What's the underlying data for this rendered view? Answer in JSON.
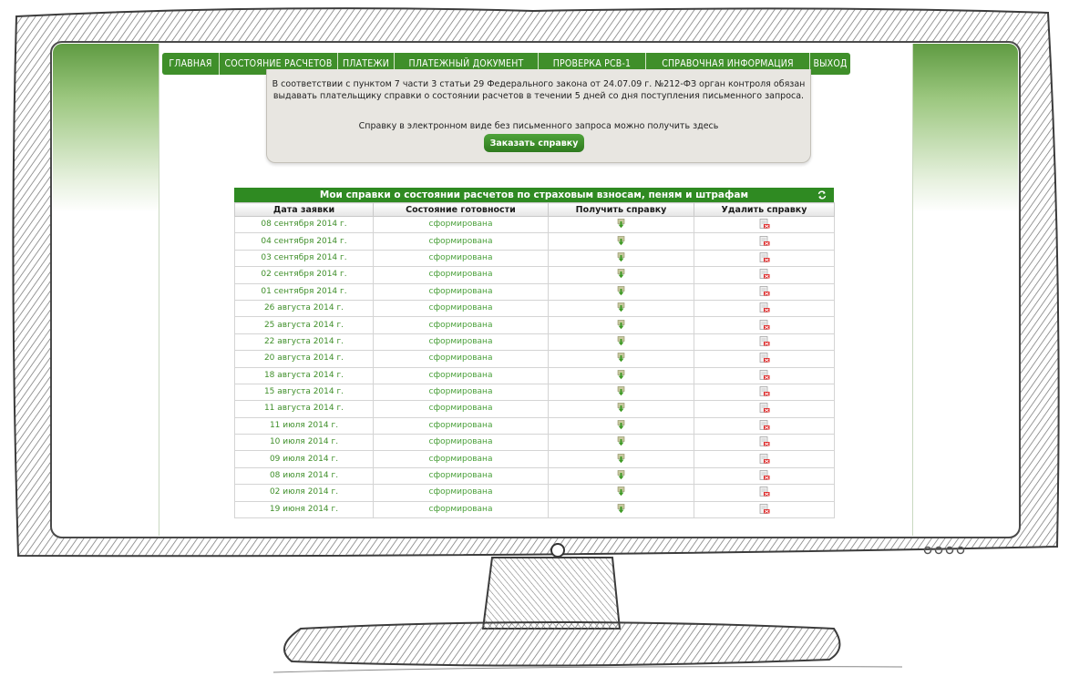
{
  "nav": {
    "items": [
      "ГЛАВНАЯ",
      "СОСТОЯНИЕ РАСЧЕТОВ",
      "ПЛАТЕЖИ",
      "ПЛАТЕЖНЫЙ ДОКУМЕНТ",
      "ПРОВЕРКА РСВ-1",
      "СПРАВОЧНАЯ ИНФОРМАЦИЯ",
      "ВЫХОД"
    ]
  },
  "notice": {
    "line1": "В соответствии с пунктом 7 части 3 статьи 29 Федерального закона от 24.07.09 г. №212-ФЗ орган контроля обязан",
    "line2": "выдавать плательщику справки о состоянии расчетов в течении 5 дней со дня поступления письменного запроса.",
    "line3": "Справку в электронном виде без письменного запроса можно получить здесь",
    "button_label": "Заказать справку"
  },
  "table": {
    "title": "Мои справки о состоянии расчетов по страховым взносам, пеням и штрафам",
    "headers": [
      "Дата заявки",
      "Состояние готовности",
      "Получить справку",
      "Удалить справку"
    ],
    "rows": [
      {
        "date": "08 сентября 2014 г.",
        "status": "сформирована"
      },
      {
        "date": "04 сентября 2014 г.",
        "status": "сформирована"
      },
      {
        "date": "03 сентября 2014 г.",
        "status": "сформирована"
      },
      {
        "date": "02 сентября 2014 г.",
        "status": "сформирована"
      },
      {
        "date": "01 сентября 2014 г.",
        "status": "сформирована"
      },
      {
        "date": "26 августа 2014 г.",
        "status": "сформирована"
      },
      {
        "date": "25 августа 2014 г.",
        "status": "сформирована"
      },
      {
        "date": "22 августа 2014 г.",
        "status": "сформирована"
      },
      {
        "date": "20 августа 2014 г.",
        "status": "сформирована"
      },
      {
        "date": "18 августа 2014 г.",
        "status": "сформирована"
      },
      {
        "date": "15 августа 2014 г.",
        "status": "сформирована"
      },
      {
        "date": "11 августа 2014 г.",
        "status": "сформирована"
      },
      {
        "date": "11 июля 2014 г.",
        "status": "сформирована"
      },
      {
        "date": "10 июля 2014 г.",
        "status": "сформирована"
      },
      {
        "date": "09 июля 2014 г.",
        "status": "сформирована"
      },
      {
        "date": "08 июля 2014 г.",
        "status": "сформирована"
      },
      {
        "date": "02 июля 2014 г.",
        "status": "сформирована"
      },
      {
        "date": "19 июня 2014 г.",
        "status": "сформирована"
      }
    ]
  },
  "colors": {
    "accent": "#3f8f2a",
    "sketch": "#555555"
  },
  "icons": {
    "download": "download-arrow-icon",
    "delete": "delete-document-icon",
    "refresh": "refresh-icon"
  }
}
